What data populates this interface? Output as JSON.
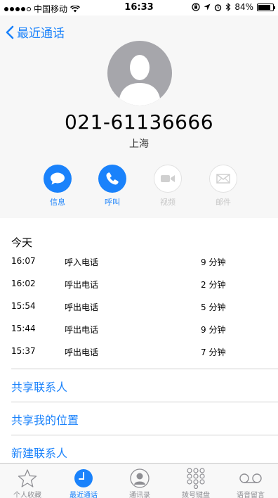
{
  "status_bar": {
    "carrier": "中国移动",
    "time": "16:33",
    "battery_percent": "84%",
    "battery_level": 0.84
  },
  "nav": {
    "back_label": "最近通话"
  },
  "contact": {
    "phone_number": "021-61136666",
    "location": "上海"
  },
  "actions": [
    {
      "label": "信息",
      "icon": "message-icon",
      "enabled": true
    },
    {
      "label": "呼叫",
      "icon": "phone-icon",
      "enabled": true
    },
    {
      "label": "视频",
      "icon": "video-icon",
      "enabled": false
    },
    {
      "label": "邮件",
      "icon": "mail-icon",
      "enabled": false
    }
  ],
  "calls": {
    "header": "今天",
    "rows": [
      {
        "time": "16:07",
        "type": "呼入电话",
        "duration": "9 分钟"
      },
      {
        "time": "16:02",
        "type": "呼出电话",
        "duration": "2 分钟"
      },
      {
        "time": "15:54",
        "type": "呼出电话",
        "duration": "5 分钟"
      },
      {
        "time": "15:44",
        "type": "呼出电话",
        "duration": "9 分钟"
      },
      {
        "time": "15:37",
        "type": "呼出电话",
        "duration": "7 分钟"
      }
    ]
  },
  "links": [
    {
      "label": "共享联系人"
    },
    {
      "label": "共享我的位置"
    },
    {
      "label": "新建联系人"
    }
  ],
  "tabs": [
    {
      "label": "个人收藏",
      "icon": "star-icon",
      "active": false
    },
    {
      "label": "最近通话",
      "icon": "clock-icon",
      "active": true
    },
    {
      "label": "通讯录",
      "icon": "contacts-icon",
      "active": false
    },
    {
      "label": "拨号键盘",
      "icon": "keypad-icon",
      "active": false
    },
    {
      "label": "语音留言",
      "icon": "voicemail-icon",
      "active": false
    }
  ],
  "colors": {
    "accent": "#1a82fb",
    "header_background": "#f7f7f7",
    "avatar": "#a6a6ab",
    "disabled": "#c6c6c6"
  }
}
